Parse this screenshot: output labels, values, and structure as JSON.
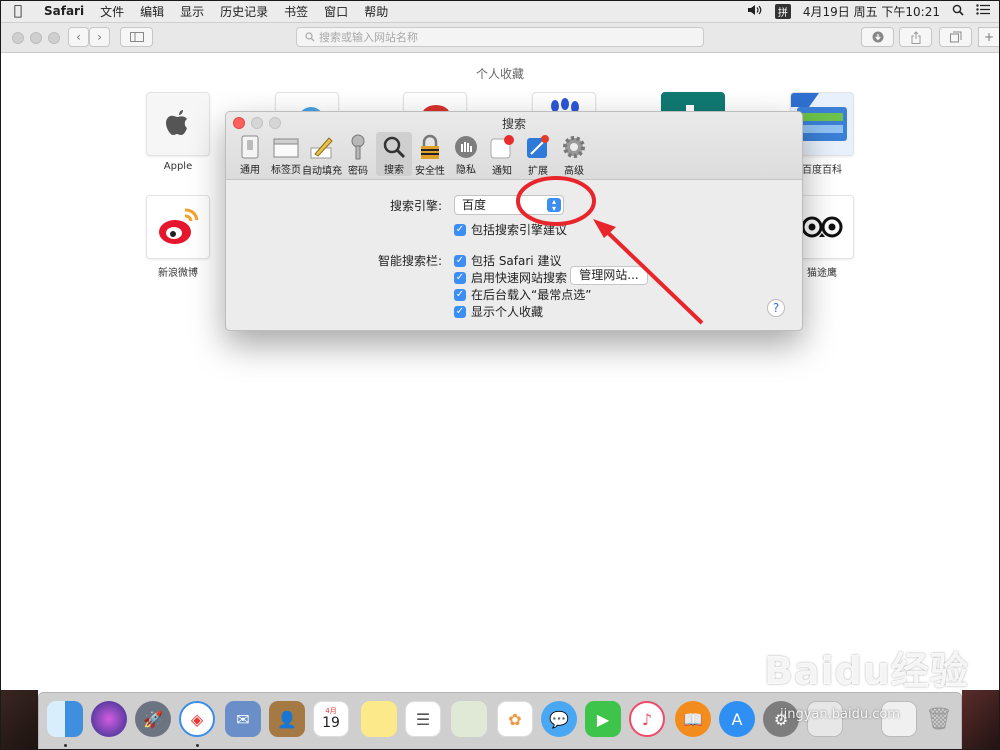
{
  "menubar": {
    "app": "Safari",
    "items": [
      "文件",
      "编辑",
      "显示",
      "历史记录",
      "书签",
      "窗口",
      "帮助"
    ],
    "ime": "拼",
    "datetime": "4月19日 周五 下午10:21"
  },
  "toolbar": {
    "address_placeholder": "搜索或输入网站名称"
  },
  "favorites": {
    "title": "个人收藏",
    "items": [
      "Apple",
      "百度百科",
      "新浪微博",
      "猫途鹰"
    ]
  },
  "prefs": {
    "title": "搜索",
    "tabs": [
      "通用",
      "标签页",
      "自动填充",
      "密码",
      "搜索",
      "安全性",
      "隐私",
      "通知",
      "扩展",
      "高级"
    ],
    "active_tab": "搜索",
    "search_engine_label": "搜索引擎:",
    "search_engine_value": "百度",
    "include_suggestions": "包括搜索引擎建议",
    "smart_field_label": "智能搜索栏:",
    "smart_options": [
      "包括 Safari 建议",
      "启用快速网站搜索",
      "在后台载入“最常点选”",
      "显示个人收藏"
    ],
    "manage_button": "管理网站...",
    "help": "?"
  },
  "dock": {
    "apps": [
      "finder-icon",
      "siri-icon",
      "launchpad-icon",
      "safari-icon",
      "mail-icon",
      "contacts-icon",
      "calendar-icon",
      "notes-icon",
      "reminders-icon",
      "preview-icon",
      "photos-icon",
      "messages-icon",
      "facetime-icon",
      "music-icon",
      "books-icon",
      "appstore-icon",
      "settings-icon",
      "screenshot-icon",
      "downloads-icon",
      "trash-icon"
    ],
    "calendar_month": "4月",
    "calendar_day": "19"
  },
  "watermark": {
    "logo": "Baidu经验",
    "url": "jingyan.baidu.com"
  },
  "colors": {
    "accent": "#3d8ef2",
    "annotation": "#e8252b"
  }
}
